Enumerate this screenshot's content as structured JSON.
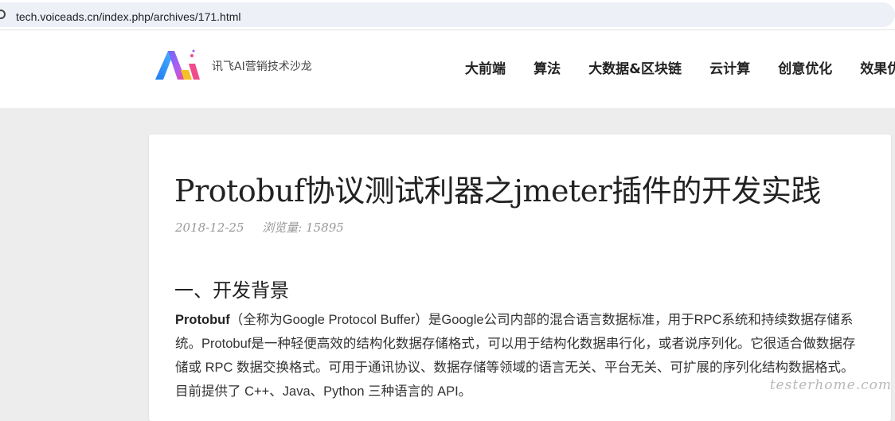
{
  "browser": {
    "url": "tech.voiceads.cn/index.php/archives/171.html"
  },
  "header": {
    "brand": "讯飞AI营销技术沙龙",
    "nav": [
      "大前端",
      "算法",
      "大数据&区块链",
      "云计算",
      "创意优化",
      "效果优"
    ]
  },
  "article": {
    "title": "Protobuf协议测试利器之jmeter插件的开发实践",
    "date": "2018-12-25",
    "views": "浏览量: 15895",
    "section_heading": "一、开发背景",
    "para_lead": "Protobuf",
    "para_rest": "（全称为Google Protocol Buffer）是Google公司内部的混合语言数据标准，用于RPC系统和持续数据存储系统。Protobuf是一种轻便高效的结构化数据存储格式，可以用于结构化数据串行化，或者说序列化。它很适合做数据存储或 RPC 数据交换格式。可用于通讯协议、数据存储等领域的语言无关、平台无关、可扩展的序列化结构数据格式。目前提供了 C++、Java、Python 三种语言的 API。"
  },
  "watermark": "testerhome.com",
  "colors": {
    "logo_blue": "#1f7cf2",
    "logo_purple": "#9b5cf5",
    "logo_pink": "#f04b8b",
    "logo_yellow": "#f7c028"
  }
}
